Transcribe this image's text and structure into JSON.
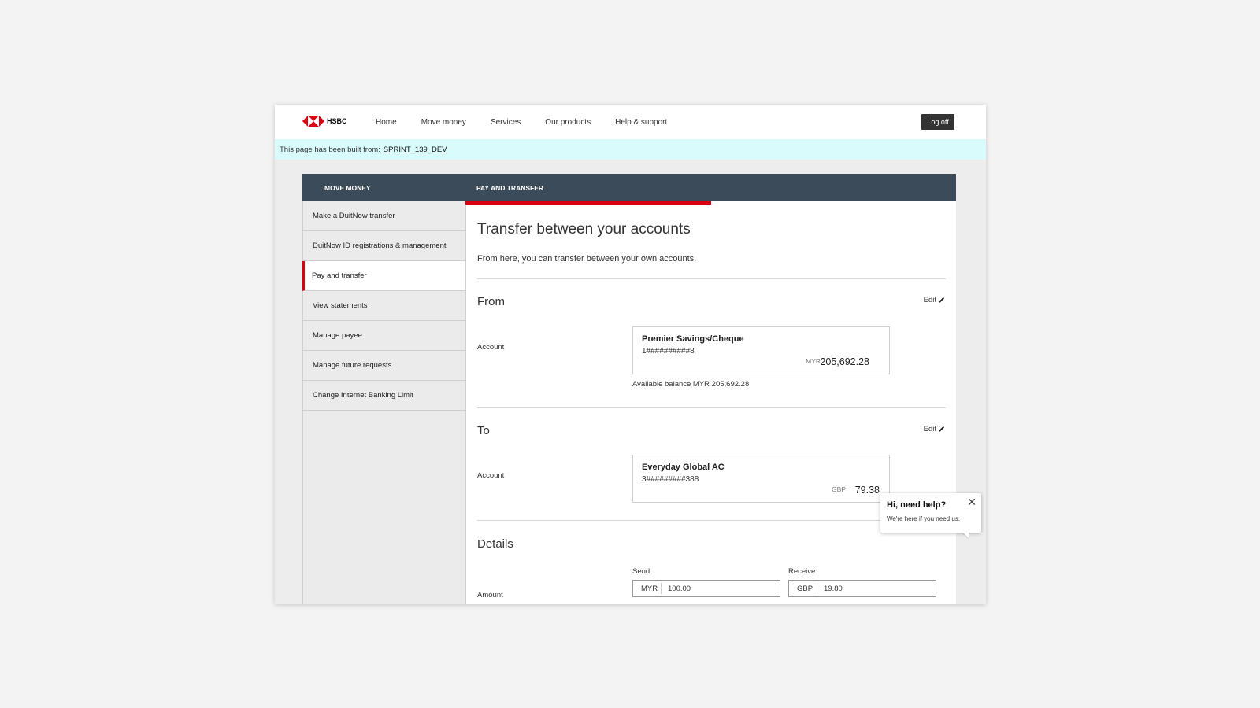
{
  "header": {
    "logo_text": "HSBC",
    "nav": [
      "Home",
      "Move money",
      "Services",
      "Our products",
      "Help & support"
    ],
    "logoff_label": "Log off"
  },
  "notice": {
    "text": "This page has been built from:",
    "link": "SPRINT_139_DEV"
  },
  "sidebar": {
    "heading": "MOVE MONEY",
    "items": [
      {
        "label": "Make a DuitNow transfer"
      },
      {
        "label": "DuitNow ID registrations & management"
      },
      {
        "label": "Pay and transfer"
      },
      {
        "label": "View statements"
      },
      {
        "label": "Manage payee"
      },
      {
        "label": "Manage future requests"
      },
      {
        "label": "Change Internet Banking Limit"
      }
    ],
    "active_index": 2
  },
  "main": {
    "tab": "PAY AND TRANSFER",
    "title": "Transfer between your accounts",
    "subtitle": "From here, you can transfer between your own accounts.",
    "edit_label": "Edit",
    "from": {
      "heading": "From",
      "field_label": "Account",
      "account_name": "Premier Savings/Cheque",
      "account_number": "1##########8",
      "currency": "MYR",
      "balance": "205,692.28",
      "available": "Available balance MYR 205,692.28"
    },
    "to": {
      "heading": "To",
      "field_label": "Account",
      "account_name": "Everyday Global AC",
      "account_number": "3#########388",
      "currency": "GBP",
      "balance": "79.38"
    },
    "details": {
      "heading": "Details",
      "amount_label": "Amount",
      "send_label": "Send",
      "receive_label": "Receive",
      "send_currency": "MYR",
      "send_value": "100.00",
      "receive_currency": "GBP",
      "receive_value": "19.80"
    }
  },
  "help": {
    "title": "Hi, need help?",
    "text": "We're here if you need us."
  },
  "colors": {
    "brand_red": "#db0011",
    "nav_dark": "#3b4b5a",
    "notice_bg": "#d9fbfb"
  }
}
